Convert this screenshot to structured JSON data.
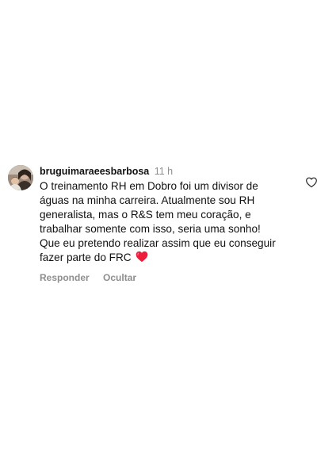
{
  "comment": {
    "username": "bruguimaraeesbarbosa",
    "timestamp": "11 h",
    "text": "O treinamento RH em Dobro foi um divisor de águas na minha carreira. Atualmente sou RH generalista, mas o R&S tem meu coração, e trabalhar somente com isso, seria uma sonho! Que eu pretendo realizar assim que eu conseguir fazer parte do FRC",
    "emoji": "red-heart",
    "reply_label": "Responder",
    "hide_label": "Ocultar",
    "like_icon": "heart-outline-icon"
  },
  "colors": {
    "text": "#111111",
    "muted": "#8e8e8e",
    "heart": "#ee1d3b",
    "background": "#ffffff"
  }
}
